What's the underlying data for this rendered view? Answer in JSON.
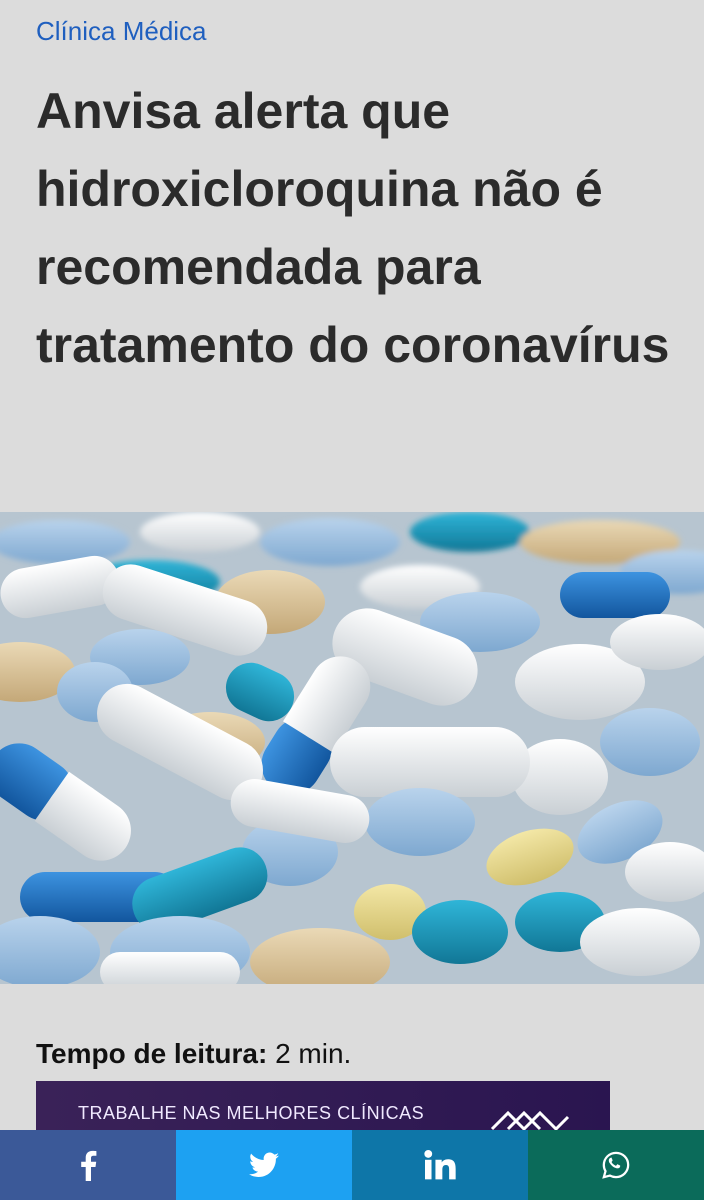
{
  "article": {
    "category": "Clínica Médica",
    "title": "Anvisa alerta que hidroxicloroquina não é recomendada para tratamento do coronavírus",
    "reading_time_label": "Tempo de leitura:",
    "reading_time_value": " 2 min."
  },
  "hero_image": {
    "icon": "pills-photo"
  },
  "ad_banner": {
    "text": "TRABALHE NAS MELHORES CLÍNICAS",
    "icon": "brand-logo-icon"
  },
  "share_bar": {
    "buttons": [
      {
        "icon": "facebook-icon",
        "color": "#3b5998"
      },
      {
        "icon": "twitter-icon",
        "color": "#1da1f2"
      },
      {
        "icon": "linkedin-icon",
        "color": "#0e76a8"
      },
      {
        "icon": "whatsapp-icon",
        "color": "#0b6b5a"
      }
    ]
  }
}
